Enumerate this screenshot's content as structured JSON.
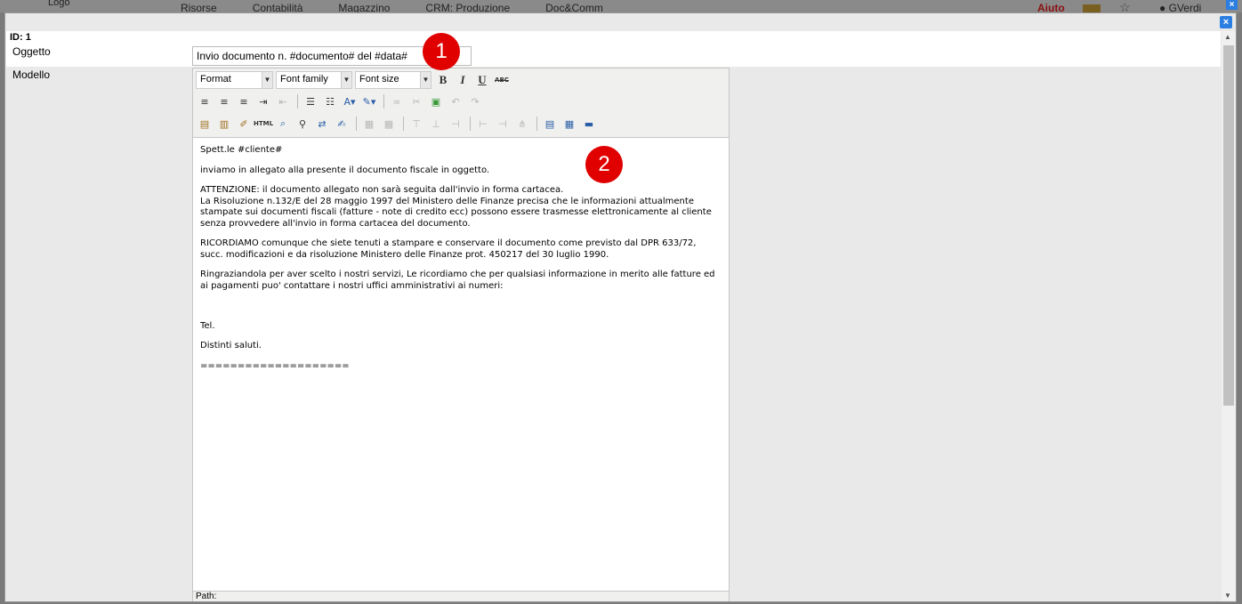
{
  "background_app": {
    "logo": "Logo",
    "nav": [
      "Risorse",
      "Contabilità",
      "Magazzino",
      "CRM: Produzione",
      "Doc&Comm"
    ],
    "help": "Aiuto",
    "user": "GVerdi"
  },
  "modal": {
    "close_icon": "close-icon",
    "id_label": "ID: 1",
    "oggetto_label": "Oggetto",
    "oggetto_value": "Invio documento n. #documento# del #data#",
    "modello_label": "Modello"
  },
  "editor": {
    "format_label": "Format",
    "font_family_label": "Font family",
    "font_size_label": "Font size",
    "bold": "B",
    "italic": "I",
    "underline": "U",
    "strike": "ABC",
    "html_button": "HTML",
    "path_label": "Path:",
    "body": {
      "greeting": "Spett.le #cliente#",
      "p1": "inviamo in allegato alla presente il documento fiscale in oggetto.",
      "p2_line1": "ATTENZIONE: il documento allegato non sarà seguita dall'invio in forma cartacea.",
      "p2_line2": "La Risoluzione n.132/E del 28 maggio 1997 del Ministero delle Finanze precisa che le informazioni attualmente stampate sui documenti fiscali (fatture - note di credito ecc) possono essere trasmesse elettronicamente al cliente senza provvedere all'invio in forma cartacea del documento.",
      "p3": "RICORDIAMO comunque che siete tenuti a stampare e conservare il documento come previsto dal DPR 633/72, succ. modificazioni e da risoluzione Ministero delle Finanze prot. 450217 del 30 luglio 1990.",
      "p4": "Ringraziandola per aver scelto i nostri servizi, Le ricordiamo che per qualsiasi informazione in merito alle fatture ed ai pagamenti puo' contattare i nostri uffici amministrativi ai numeri:",
      "tel": "Tel.",
      "closing": "Distinti saluti.",
      "separator": "===================="
    }
  },
  "callouts": [
    "1",
    "2"
  ],
  "colors": {
    "accent": "#2a7de1",
    "callout": "#e00000"
  }
}
